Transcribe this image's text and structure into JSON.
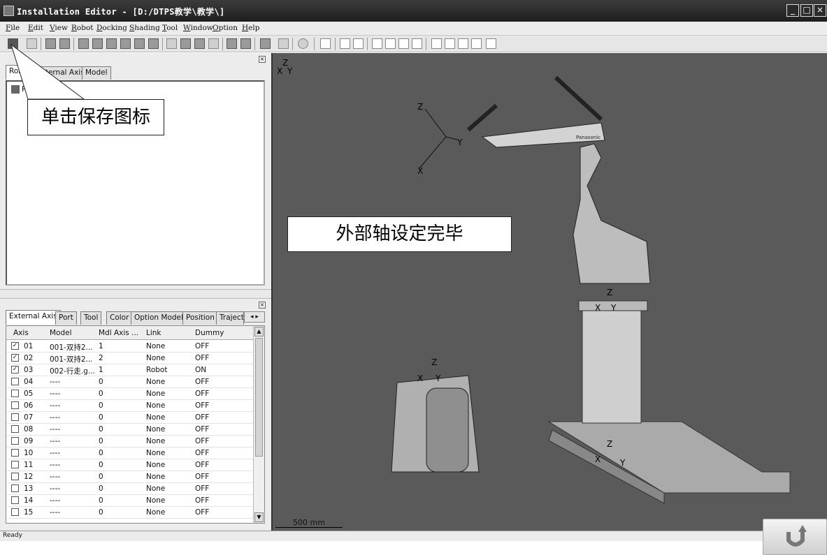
{
  "window": {
    "title": "Installation Editor - [D:/DTPS教学\\教学\\]",
    "controls": [
      "minimize",
      "maximize",
      "close"
    ]
  },
  "menu": [
    "File",
    "Edit",
    "View",
    "Robot",
    "Docking",
    "Shading",
    "Tool",
    "Window",
    "Option",
    "Help"
  ],
  "top_panel": {
    "tabs": [
      "Robot",
      "External Axis",
      "Model"
    ],
    "active_tab": "Robot",
    "tree_item": "R001-",
    "callout": "单击保存图标"
  },
  "bottom_panel": {
    "tabs": [
      "External Axis",
      "Port",
      "Tool",
      "Color",
      "Option Model",
      "Position",
      "Traject"
    ],
    "active_tab": "External Axis",
    "columns": [
      "Axis",
      "Model",
      "Mdl Axis ...",
      "Link",
      "Dummy"
    ],
    "rows": [
      {
        "checked": true,
        "axis": "01",
        "model": "001-双持2...",
        "mdl_axis": "1",
        "link": "None",
        "dummy": "OFF"
      },
      {
        "checked": true,
        "axis": "02",
        "model": "001-双持2...",
        "mdl_axis": "2",
        "link": "None",
        "dummy": "OFF"
      },
      {
        "checked": true,
        "axis": "03",
        "model": "002-行走.g...",
        "mdl_axis": "1",
        "link": "Robot",
        "dummy": "ON"
      },
      {
        "checked": false,
        "axis": "04",
        "model": "----",
        "mdl_axis": "0",
        "link": "None",
        "dummy": "OFF"
      },
      {
        "checked": false,
        "axis": "05",
        "model": "----",
        "mdl_axis": "0",
        "link": "None",
        "dummy": "OFF"
      },
      {
        "checked": false,
        "axis": "06",
        "model": "----",
        "mdl_axis": "0",
        "link": "None",
        "dummy": "OFF"
      },
      {
        "checked": false,
        "axis": "07",
        "model": "----",
        "mdl_axis": "0",
        "link": "None",
        "dummy": "OFF"
      },
      {
        "checked": false,
        "axis": "08",
        "model": "----",
        "mdl_axis": "0",
        "link": "None",
        "dummy": "OFF"
      },
      {
        "checked": false,
        "axis": "09",
        "model": "----",
        "mdl_axis": "0",
        "link": "None",
        "dummy": "OFF"
      },
      {
        "checked": false,
        "axis": "10",
        "model": "----",
        "mdl_axis": "0",
        "link": "None",
        "dummy": "OFF"
      },
      {
        "checked": false,
        "axis": "11",
        "model": "----",
        "mdl_axis": "0",
        "link": "None",
        "dummy": "OFF"
      },
      {
        "checked": false,
        "axis": "12",
        "model": "----",
        "mdl_axis": "0",
        "link": "None",
        "dummy": "OFF"
      },
      {
        "checked": false,
        "axis": "13",
        "model": "----",
        "mdl_axis": "0",
        "link": "None",
        "dummy": "OFF"
      },
      {
        "checked": false,
        "axis": "14",
        "model": "----",
        "mdl_axis": "0",
        "link": "None",
        "dummy": "OFF"
      },
      {
        "checked": false,
        "axis": "15",
        "model": "----",
        "mdl_axis": "0",
        "link": "None",
        "dummy": "OFF"
      }
    ]
  },
  "viewport": {
    "corner_axes": {
      "z": "Z",
      "x": "X",
      "y": "Y"
    },
    "callout": "外部轴设定完毕",
    "scale_label": "500 mm",
    "robot_label": "Panasonic"
  },
  "status": "Ready",
  "icons": [
    "app-icon",
    "save-icon",
    "back-arrow-icon"
  ]
}
